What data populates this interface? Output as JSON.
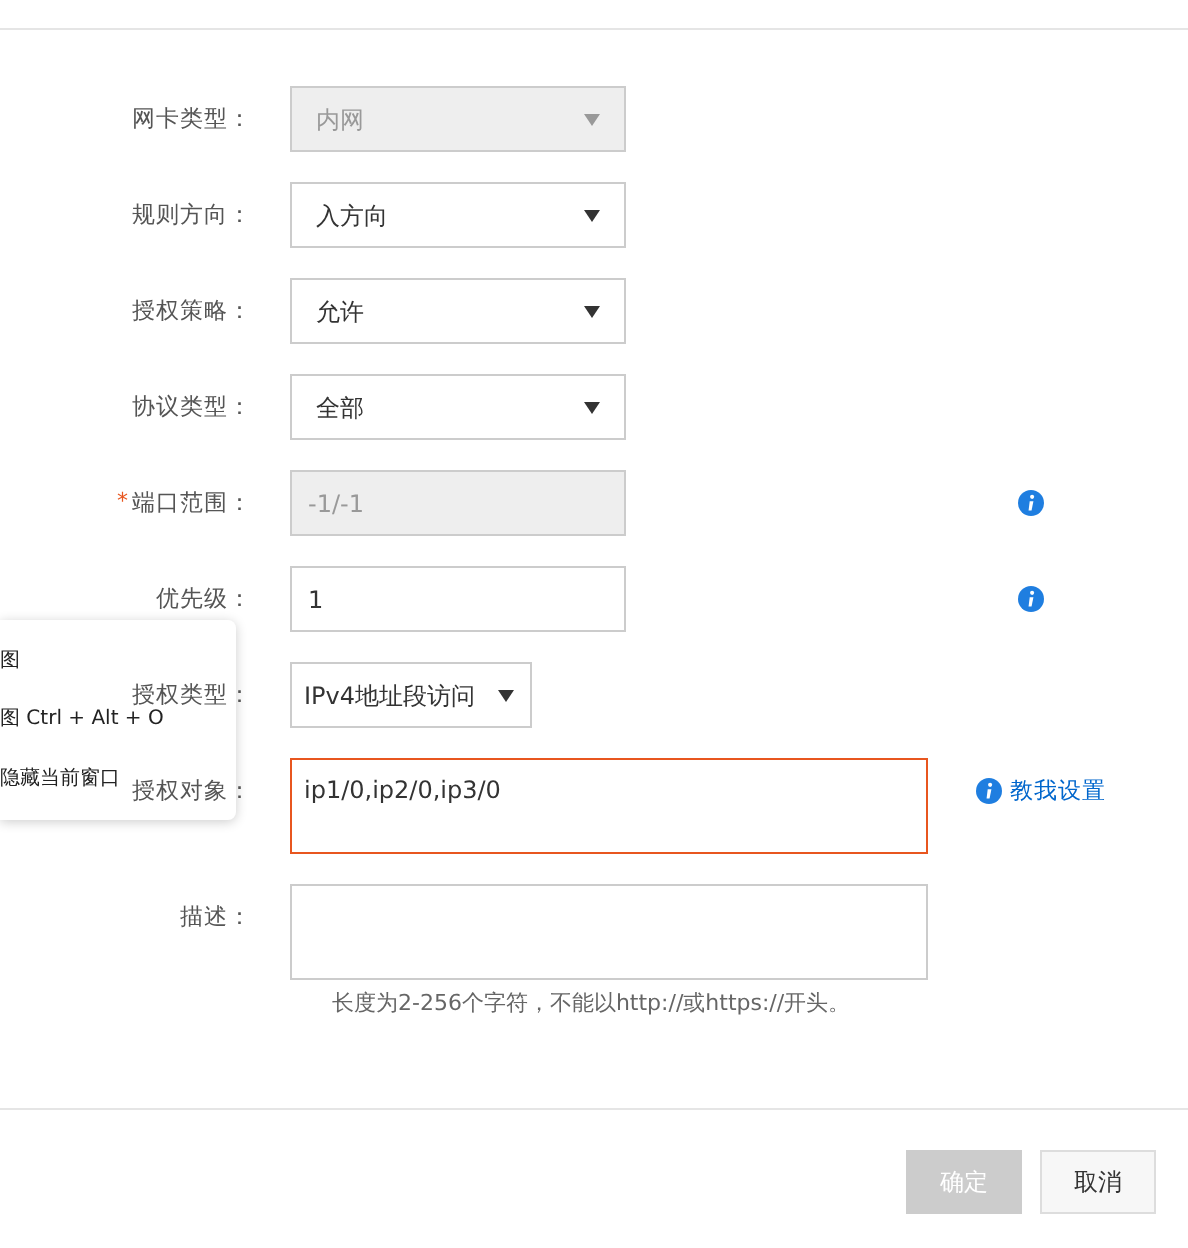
{
  "form": {
    "fields": [
      {
        "label": "网卡类型：",
        "kind": "select",
        "value": "内网",
        "disabled": true,
        "required": false,
        "info": false
      },
      {
        "label": "规则方向：",
        "kind": "select",
        "value": "入方向",
        "disabled": false,
        "required": false,
        "info": false
      },
      {
        "label": "授权策略：",
        "kind": "select",
        "value": "允许",
        "disabled": false,
        "required": false,
        "info": false
      },
      {
        "label": "协议类型：",
        "kind": "select",
        "value": "全部",
        "disabled": false,
        "required": false,
        "info": false
      },
      {
        "label": "端口范围：",
        "kind": "input",
        "value": "-1/-1",
        "disabled": true,
        "required": true,
        "required_mark": "*",
        "info": true
      },
      {
        "label": "优先级：",
        "kind": "input",
        "value": "1",
        "disabled": false,
        "required": false,
        "info": true
      },
      {
        "label": "授权类型：",
        "kind": "small-select",
        "value": "IPv4地址段访问",
        "disabled": false,
        "required": false,
        "info": false
      },
      {
        "label": "授权对象：",
        "kind": "textarea",
        "value": "ip1/0,ip2/0,ip3/0",
        "disabled": false,
        "required": false,
        "info": false,
        "error": true,
        "help_link": "教我设置"
      },
      {
        "label": "描述：",
        "kind": "textarea",
        "disabled": false,
        "required": false,
        "info": false,
        "error": false,
        "hint": "长度为2-256个字符，不能以http://或https://开头。"
      }
    ]
  },
  "context_menu": {
    "items": [
      "图",
      "图 Ctrl + Alt + O",
      "隐藏当前窗口"
    ]
  },
  "buttons": [
    {
      "label": "确定",
      "disabled": true
    },
    {
      "label": "取消",
      "disabled": false
    }
  ]
}
